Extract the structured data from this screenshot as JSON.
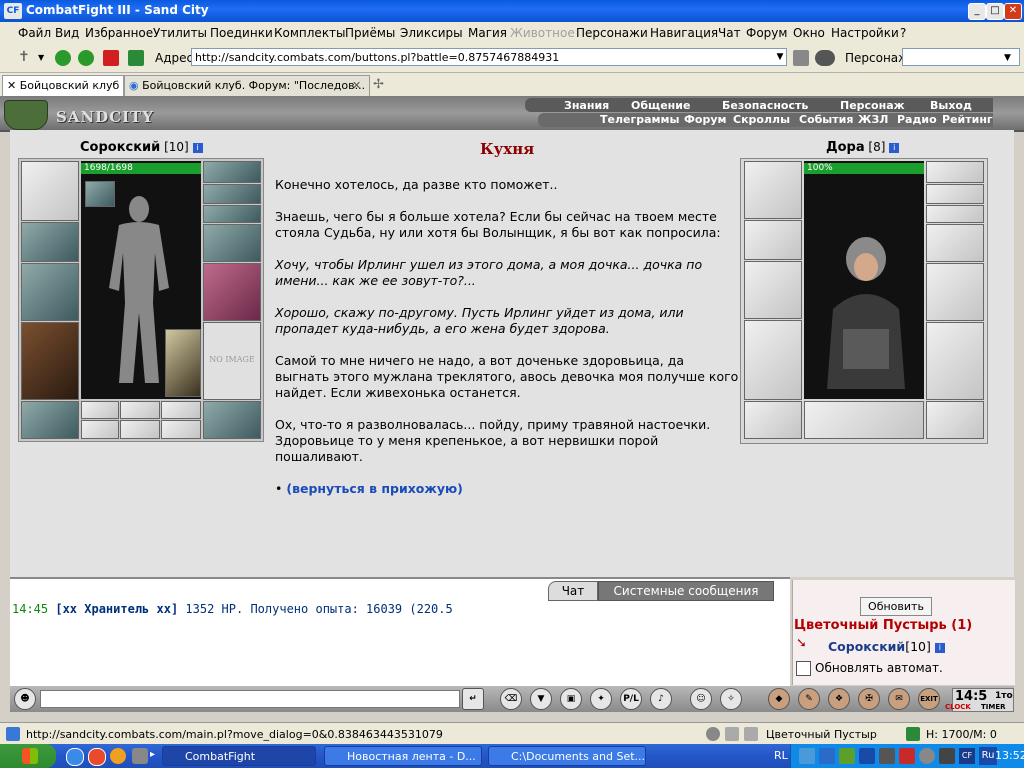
{
  "window": {
    "title": "CombatFight III - Sand City",
    "logo": "CF"
  },
  "menu": [
    "Файл",
    "Вид",
    "Избранное",
    "Утилиты",
    "Поединки",
    "Комплекты",
    "Приёмы",
    "Эликсиры",
    "Магия",
    "Животное",
    "Персонажи",
    "Навигация",
    "Чат",
    "Форум",
    "Окно",
    "Настройки",
    "?"
  ],
  "menu_disabled": "Животное",
  "address": {
    "label": "Адрес:",
    "url": "http://sandcity.combats.com/buttons.pl?battle=0.8757467884931",
    "character_label": "Персонаж:"
  },
  "tabs": [
    {
      "label": "Бойцовский клуб"
    },
    {
      "label": "Бойцовский клуб. Форум: \"Последов..."
    }
  ],
  "game": {
    "logo": "SANDCITY",
    "nav_top": [
      "Знания",
      "Общение",
      "Безопасность",
      "Персонаж",
      "Выход"
    ],
    "nav_bottom": [
      "Телеграммы",
      "Форум",
      "Скроллы",
      "События",
      "ЖЗЛ",
      "Радио",
      "Рейтинг"
    ]
  },
  "player": {
    "name": "Сорокский",
    "level": "[10]",
    "hp": "1698/1698",
    "hp_fraction": 1.0,
    "no_image": "NO IMAGE"
  },
  "npc": {
    "name": "Дора",
    "level": "[8]",
    "hp": "100%",
    "hp_fraction": 1.0
  },
  "room": {
    "title": "Кухня"
  },
  "dialog": {
    "p1": "Конечно хотелось, да разве кто поможет..",
    "p2": "Знаешь, чего бы я больше хотела? Если бы сейчас на твоем месте стояла Судьба, ну или хотя бы Волынщик, я бы вот как попросила:",
    "p3": "Хочу, чтобы Ирлинг ушел из этого дома, а моя дочка... дочка по имени... как же ее зовут-то?...",
    "p4": "Хорошо, скажу по-другому. Пусть Ирлинг уйдет из дома, или пропадет куда-нибудь, а его жена будет здорова.",
    "p5": "Самой то мне ничего не надо, а вот доченьке здоровьица, да выгнать этого мужлана треклятого, авось девочка моя получше кого найдет. Если живехонька останется.",
    "p6": "Ох, что-то я разволновалась... пойду, приму травяной настоечки. Здоровьице то у меня крепенькое, а вот нервишки порой пошаливают.",
    "bullet": "•",
    "link": "(вернуться в прихожую)"
  },
  "chat": {
    "tabs": [
      "Чат",
      "Системные сообщения"
    ],
    "time": "14:45",
    "sender": "[xx Хранитель xx]",
    "message": "1352 НР. Получено опыта: 16039 (220.5"
  },
  "location_panel": {
    "refresh": "Обновить",
    "location": "Цветочный Пустырь (1)",
    "player": "Сорокский",
    "player_level": "[10]",
    "auto_refresh": "Обновлять автомат."
  },
  "clock": {
    "time": "14:5",
    "sub": "1то",
    "clock_label": "CLOCK",
    "timer_label": "TIMER"
  },
  "status": {
    "url": "http://sandcity.combats.com/main.pl?move_dialog=0&0.838463443531079",
    "location": "Цветочный Пустыр",
    "hm": "Н: 1700/М: 0"
  },
  "taskbar": {
    "items": [
      "CombatFight",
      "Новостная лента - D...",
      "C:\\Documents and Set..."
    ],
    "lang": "RL",
    "lang2": "Ru",
    "time": "13:52"
  },
  "colors": {
    "room_title": "#8b0000",
    "link": "#1a4bb8",
    "location": "#b30000",
    "hp": "#1a9f2f"
  }
}
